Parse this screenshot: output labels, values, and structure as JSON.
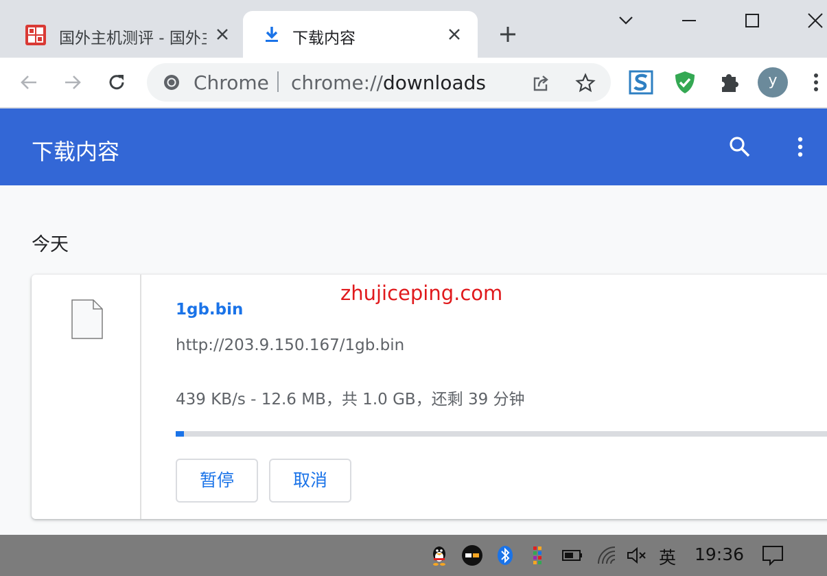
{
  "tabs": [
    {
      "title": "国外主机测评 - 国外主机测评",
      "favicon": "site-seal-icon",
      "active": false
    },
    {
      "title": "下载内容",
      "favicon": "download-arrow-icon",
      "active": true
    }
  ],
  "omnibox": {
    "chip": "Chrome",
    "url_scheme": "chrome://",
    "url_host": "downloads"
  },
  "avatar_letter": "y",
  "page": {
    "header_title": "下载内容",
    "date_group": "今天"
  },
  "download": {
    "file_name": "1gb.bin",
    "url": "http://203.9.150.167/1gb.bin",
    "status": "439 KB/s - 12.6 MB，共 1.0 GB，还剩 39 分钟",
    "progress_fraction": 0.0123,
    "pause_label": "暂停",
    "cancel_label": "取消"
  },
  "watermark": "zhujiceping.com",
  "taskbar": {
    "ime": "英",
    "time": "19:36"
  },
  "colors": {
    "header": "#3367d6",
    "accent": "#1a73e8",
    "watermark": "#e0191c"
  }
}
